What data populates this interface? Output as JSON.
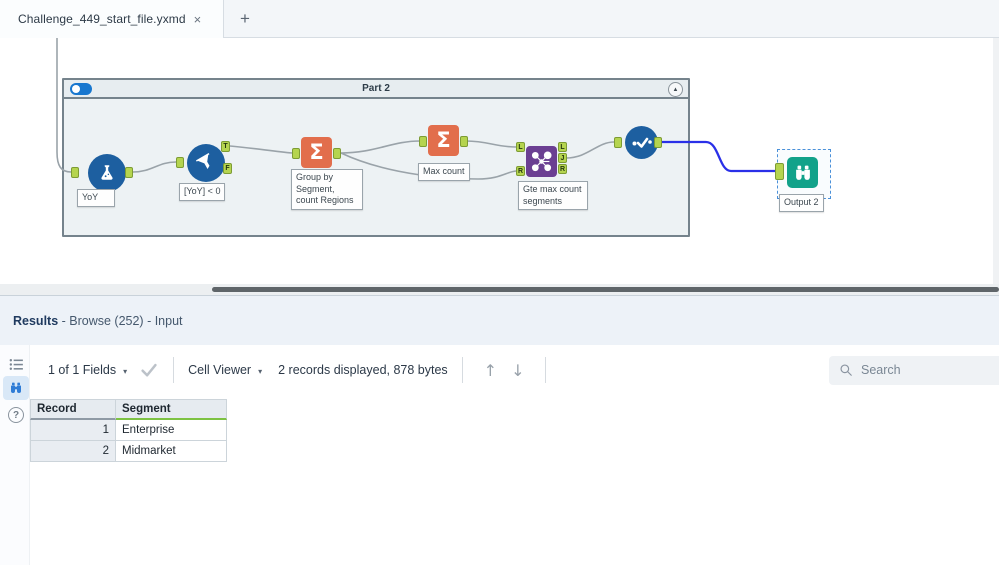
{
  "window": {
    "tab_label": "Challenge_449_start_file.yxmd",
    "close_glyph": "×",
    "new_tab_glyph": "+"
  },
  "canvas": {
    "container": {
      "title": "Part 2",
      "collapse_glyph": "▲"
    },
    "tools": {
      "formula": {
        "label": "YoY"
      },
      "filter": {
        "label": "[YoY] < 0",
        "anchors": {
          "t": "T",
          "f": "F"
        }
      },
      "summarize_group": {
        "label": "Group by Segment, count Regions",
        "glyph": "Σ"
      },
      "summarize_max": {
        "label": "Max count",
        "glyph": "Σ"
      },
      "join": {
        "label": "Gte max count segments",
        "anchors": {
          "l": "L",
          "j": "J",
          "r": "R"
        }
      },
      "browse": {
        "label": "Output 2"
      }
    }
  },
  "results": {
    "title": "Results",
    "subtitle": " - Browse (252) - Input",
    "help_glyph": "?",
    "toolbar": {
      "fields": "1 of 1 Fields",
      "caret": "▾",
      "cell_viewer": "Cell Viewer",
      "records": "2 records displayed, 878 bytes",
      "up_glyph": "↑",
      "down_glyph": "↓",
      "search_placeholder": "Search"
    },
    "table": {
      "columns": [
        "Record",
        "Segment"
      ],
      "rows": [
        {
          "record": "1",
          "segment": "Enterprise"
        },
        {
          "record": "2",
          "segment": "Midmarket"
        }
      ]
    }
  },
  "colors": {
    "tool_blue": "#1d5fa0",
    "summarize_orange": "#e26e4c",
    "join_purple": "#6b3f92",
    "browse_teal": "#12a28a",
    "anchor_green": "#b5d44f",
    "wire_gray": "#9aa3a9",
    "selected_wire_blue": "#2a30e8",
    "string_type_green": "#7dc242"
  }
}
